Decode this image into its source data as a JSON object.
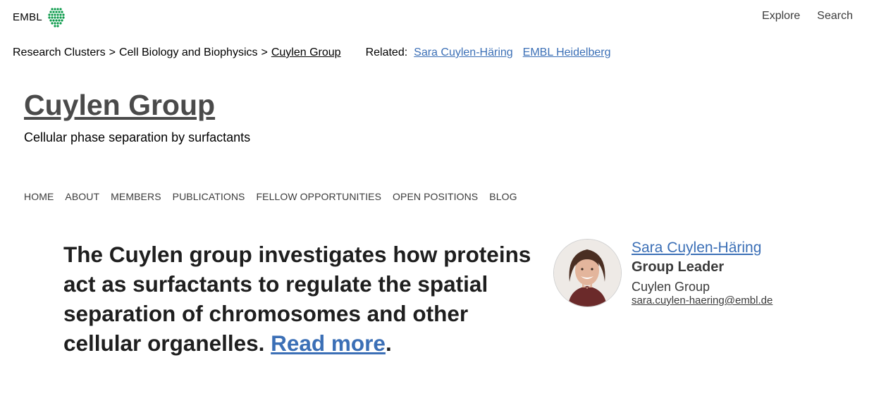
{
  "header": {
    "logo_text": "EMBL",
    "nav": [
      {
        "label": "Explore"
      },
      {
        "label": "Search"
      }
    ]
  },
  "breadcrumb": {
    "items": [
      "Research Clusters",
      "Cell Biology and Biophysics",
      "Cuylen Group"
    ],
    "separator": ">",
    "related_label": "Related:",
    "related_links": [
      "Sara Cuylen-Häring",
      "EMBL Heidelberg"
    ]
  },
  "group": {
    "title": "Cuylen Group",
    "subtitle": "Cellular phase separation by surfactants"
  },
  "main_nav": [
    "HOME",
    "ABOUT",
    "MEMBERS",
    "PUBLICATIONS",
    "FELLOW OPPORTUNITIES",
    "OPEN POSITIONS",
    "BLOG"
  ],
  "intro": {
    "text": "The Cuylen group investigates how proteins act as surfactants to regulate the spatial separation of chromosomes and other cellular organelles. ",
    "link_text": "Read more",
    "trailing": "."
  },
  "leader": {
    "name": "Sara Cuylen-Häring",
    "role": "Group Leader",
    "group": "Cuylen Group",
    "email": "sara.cuylen-haering@embl.de"
  },
  "colors": {
    "link": "#3b6fb6",
    "logo_green": "#0a9a4a",
    "title_gray": "#4a4a4a"
  }
}
